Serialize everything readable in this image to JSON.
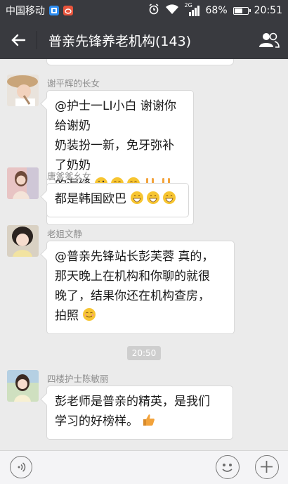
{
  "status_bar": {
    "carrier": "中国移动",
    "network": "2G",
    "battery_percent": "68%",
    "battery_level": 0.68,
    "time": "20:51",
    "icons": [
      "notification-app-icon",
      "weibo-icon",
      "alarm-icon",
      "wifi-icon",
      "signal-icon",
      "battery-icon"
    ]
  },
  "header": {
    "title": "普亲先锋养老机构(143)",
    "icons": [
      "back-arrow-icon",
      "group-members-icon"
    ]
  },
  "messages": [
    {
      "sender": "谢平辉的长女",
      "text": "@护士一LI小白 谢谢你给谢奶奶装扮一新，免牙弥补了奶奶的漏缝",
      "lines": [
        "@护士一LI小白 谢谢你给谢奶",
        "奶装扮一新，免牙弥补了奶奶",
        "的漏缝"
      ],
      "emojis": [
        "tongue-wink-emoji",
        "smile-emoji",
        "smile-emoji",
        "rock-hand-emoji",
        "rock-hand-emoji",
        "rock-hand-emoji"
      ]
    },
    {
      "sender": "唐爹爹幺女",
      "text": "都是韩国欧巴",
      "emojis": [
        "grin-emoji",
        "grin-emoji",
        "grin-emoji"
      ]
    },
    {
      "sender": "老姐文静",
      "text": "@普亲先锋站长彭芙蓉 真的，那天晚上在机构和你聊的就很晚了，结果你还在机构查房，拍照",
      "lines": [
        "@普亲先锋站长彭芙蓉 真的，",
        "那天晚上在机构和你聊的就很",
        "晚了，结果你还在机构查房，",
        "拍照"
      ],
      "emojis": [
        "smile-emoji"
      ]
    },
    {
      "sender": "四楼护士陈敏丽",
      "text": "彭老师是普亲的精英，是我们学习的好榜样。",
      "lines": [
        "彭老师是普亲的精英，是我们",
        "学习的好榜样。"
      ],
      "emojis": [
        "thumbs-up-emoji"
      ]
    }
  ],
  "time_separator": "20:50",
  "input_bar": {
    "icons": [
      "voice-input-icon",
      "emoji-face-icon",
      "plus-icon"
    ]
  },
  "colors": {
    "header_bg": "#393a3f",
    "chat_bg": "#ebebeb",
    "bubble_bg": "#ffffff",
    "sender_text": "#8d8d8d"
  }
}
